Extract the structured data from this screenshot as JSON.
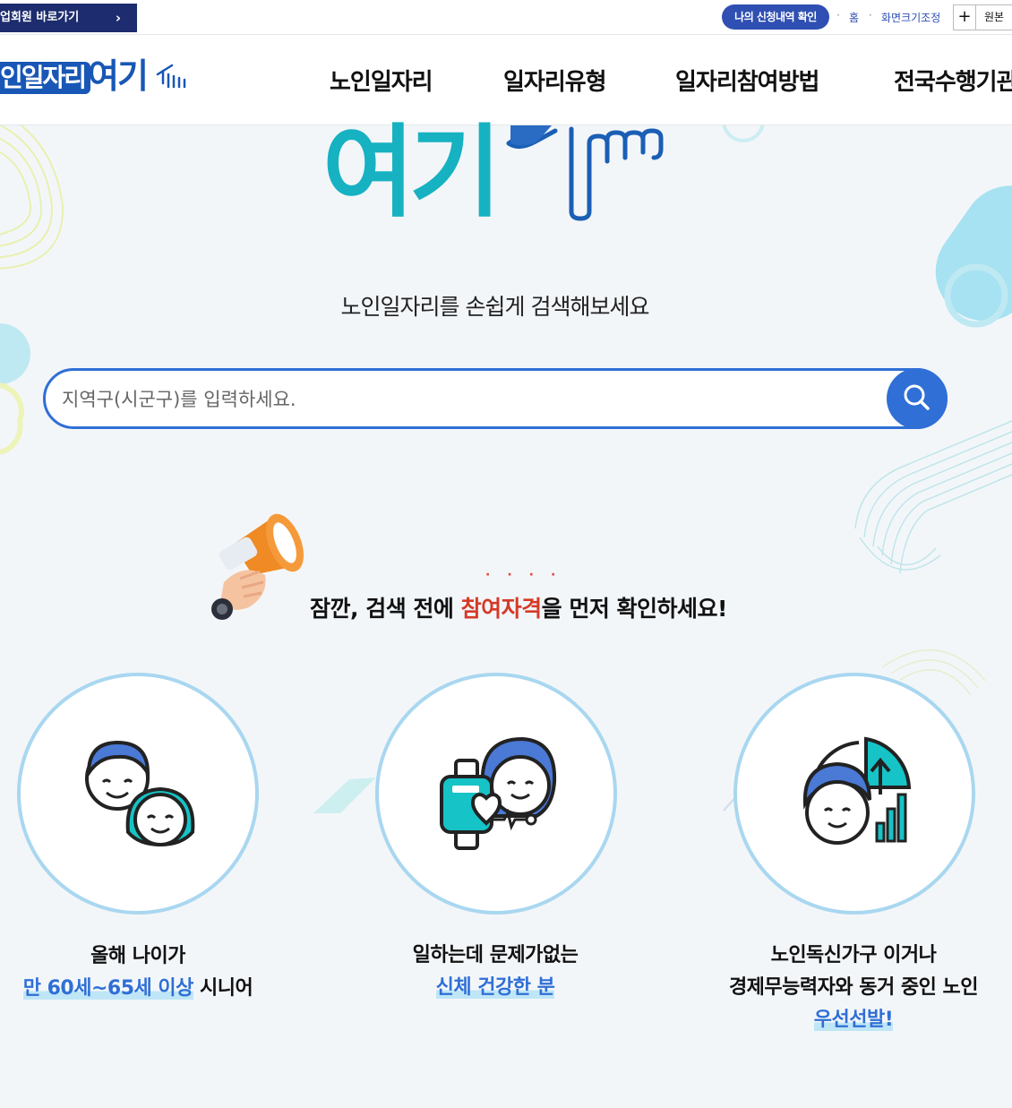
{
  "topbar": {
    "member_link": "업회원 바로가기",
    "member_arrow": "›",
    "apply_check": "나의 신청내역 확인",
    "home": "홈",
    "font_size": "화면크기조정",
    "zoom_in": "+",
    "original": "원본"
  },
  "header": {
    "logo_part1": "인일자리",
    "logo_part2": "여기",
    "nav": [
      "노인일자리",
      "일자리유형",
      "일자리참여방법",
      "전국수행기관"
    ]
  },
  "hero": {
    "title": "여기",
    "subtitle": "노인일자리를 손쉽게 검색해보세요"
  },
  "search": {
    "placeholder": "지역구(시군구)를 입력하세요.",
    "icon": "search-icon"
  },
  "notice": {
    "before": "잠깐, 검색 전에 ",
    "highlight": "참여자격",
    "after": "을 먼저 확인하세요!",
    "dots": "····"
  },
  "cards": [
    {
      "line1": "올해 나이가",
      "highlight": "만 60세~65세 이상",
      "line2_after": " 시니어",
      "icon": "seniors-couple-icon"
    },
    {
      "line1": "일하는데 문제가없는",
      "highlight": "신체 건강한 분",
      "icon": "health-watch-icon"
    },
    {
      "line1": "노인독신가구 이거나",
      "line2": "경제무능력자와 동거 중인 노인",
      "highlight": "우선선발!",
      "icon": "priority-chart-icon"
    }
  ],
  "colors": {
    "brand_navy": "#1c2c6e",
    "brand_blue": "#2f6fd6",
    "accent_teal": "#16b2c2",
    "highlight_red": "#d53a27"
  }
}
